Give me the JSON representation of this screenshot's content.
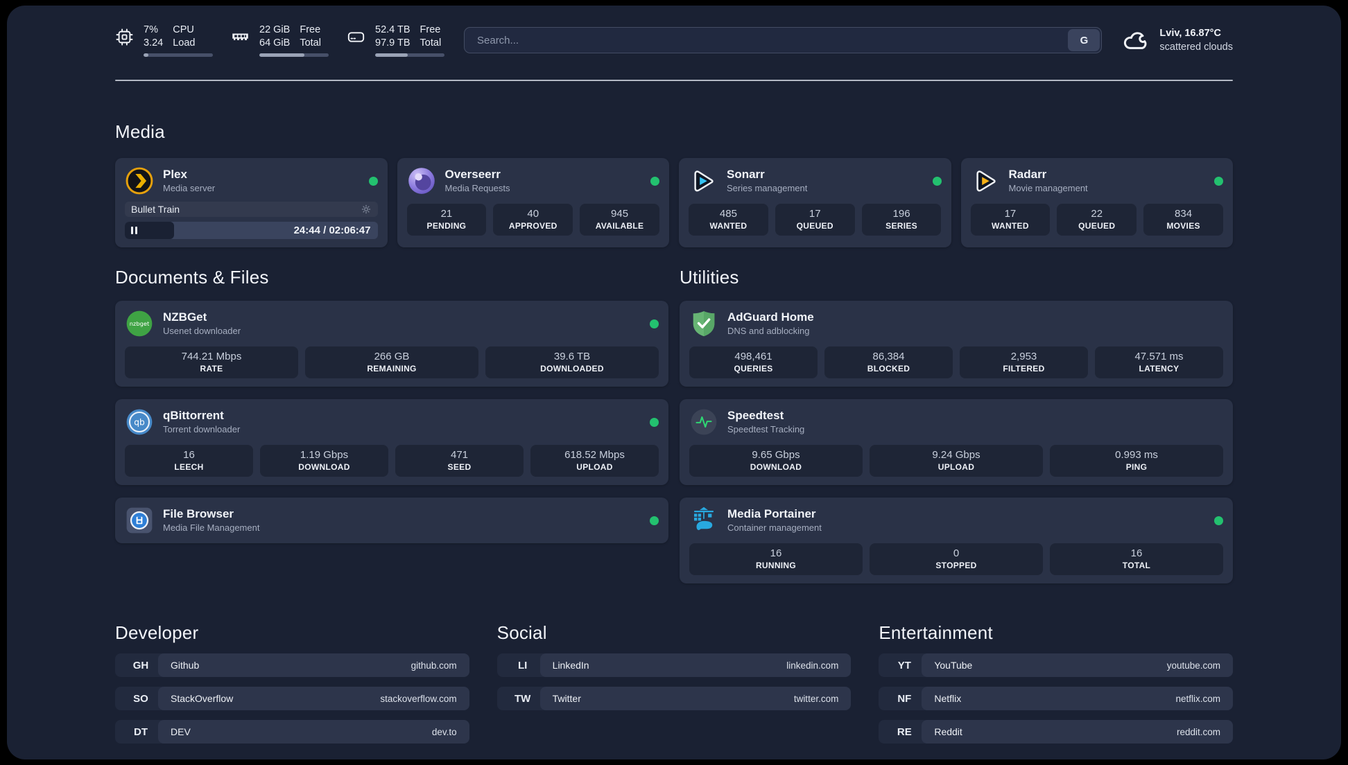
{
  "colors": {
    "status_online": "#23c16f",
    "panel_background": "#1a2133",
    "card_background": "#2a3247"
  },
  "topbar": {
    "stats": [
      {
        "id": "cpu",
        "icon": "cpu-icon",
        "values": [
          "7%",
          "3.24"
        ],
        "labels": [
          "CPU",
          "Load"
        ],
        "progress_percent": 7
      },
      {
        "id": "memory",
        "icon": "ram-icon",
        "values": [
          "22 GiB",
          "64 GiB"
        ],
        "labels": [
          "Free",
          "Total"
        ],
        "progress_percent": 65
      },
      {
        "id": "storage",
        "icon": "disk-icon",
        "values": [
          "52.4 TB",
          "97.9 TB"
        ],
        "labels": [
          "Free",
          "Total"
        ],
        "progress_percent": 46.5
      }
    ],
    "search": {
      "placeholder": "Search...",
      "engine_button": "G"
    },
    "weather": {
      "icon": "cloud-icon",
      "location_temp": "Lviv, 16.87°C",
      "condition": "scattered clouds"
    }
  },
  "sections": {
    "media": "Media",
    "documents": "Documents & Files",
    "utilities": "Utilities",
    "developer": "Developer",
    "social": "Social",
    "entertainment": "Entertainment"
  },
  "apps": {
    "plex": {
      "name": "Plex",
      "subtitle": "Media server",
      "online": true,
      "now_playing": {
        "title": "Bullet Train",
        "time": "24:44 / 02:06:47",
        "progress_percent": 19.5
      }
    },
    "overseerr": {
      "name": "Overseerr",
      "subtitle": "Media Requests",
      "online": true,
      "stats": [
        {
          "value": "21",
          "label": "PENDING"
        },
        {
          "value": "40",
          "label": "APPROVED"
        },
        {
          "value": "945",
          "label": "AVAILABLE"
        }
      ]
    },
    "sonarr": {
      "name": "Sonarr",
      "subtitle": "Series management",
      "online": true,
      "stats": [
        {
          "value": "485",
          "label": "WANTED"
        },
        {
          "value": "17",
          "label": "QUEUED"
        },
        {
          "value": "196",
          "label": "SERIES"
        }
      ]
    },
    "radarr": {
      "name": "Radarr",
      "subtitle": "Movie management",
      "online": true,
      "stats": [
        {
          "value": "17",
          "label": "WANTED"
        },
        {
          "value": "22",
          "label": "QUEUED"
        },
        {
          "value": "834",
          "label": "MOVIES"
        }
      ]
    },
    "nzbget": {
      "name": "NZBGet",
      "subtitle": "Usenet downloader",
      "online": true,
      "stats": [
        {
          "value": "744.21 Mbps",
          "label": "RATE"
        },
        {
          "value": "266 GB",
          "label": "REMAINING"
        },
        {
          "value": "39.6 TB",
          "label": "DOWNLOADED"
        }
      ]
    },
    "qbittorrent": {
      "name": "qBittorrent",
      "subtitle": "Torrent downloader",
      "online": true,
      "stats": [
        {
          "value": "16",
          "label": "LEECH"
        },
        {
          "value": "1.19 Gbps",
          "label": "DOWNLOAD"
        },
        {
          "value": "471",
          "label": "SEED"
        },
        {
          "value": "618.52 Mbps",
          "label": "UPLOAD"
        }
      ]
    },
    "filebrowser": {
      "name": "File Browser",
      "subtitle": "Media File Management",
      "online": true
    },
    "adguard": {
      "name": "AdGuard Home",
      "subtitle": "DNS and adblocking",
      "online": false,
      "stats": [
        {
          "value": "498,461",
          "label": "QUERIES"
        },
        {
          "value": "86,384",
          "label": "BLOCKED"
        },
        {
          "value": "2,953",
          "label": "FILTERED"
        },
        {
          "value": "47.571 ms",
          "label": "LATENCY"
        }
      ]
    },
    "speedtest": {
      "name": "Speedtest",
      "subtitle": "Speedtest Tracking",
      "online": false,
      "stats": [
        {
          "value": "9.65 Gbps",
          "label": "DOWNLOAD"
        },
        {
          "value": "9.24 Gbps",
          "label": "UPLOAD"
        },
        {
          "value": "0.993 ms",
          "label": "PING"
        }
      ]
    },
    "portainer": {
      "name": "Media Portainer",
      "subtitle": "Container management",
      "online": true,
      "stats": [
        {
          "value": "16",
          "label": "RUNNING"
        },
        {
          "value": "0",
          "label": "STOPPED"
        },
        {
          "value": "16",
          "label": "TOTAL"
        }
      ]
    }
  },
  "links": {
    "developer": [
      {
        "abbr": "GH",
        "name": "Github",
        "url": "github.com"
      },
      {
        "abbr": "SO",
        "name": "StackOverflow",
        "url": "stackoverflow.com"
      },
      {
        "abbr": "DT",
        "name": "DEV",
        "url": "dev.to"
      }
    ],
    "social": [
      {
        "abbr": "LI",
        "name": "LinkedIn",
        "url": "linkedin.com"
      },
      {
        "abbr": "TW",
        "name": "Twitter",
        "url": "twitter.com"
      }
    ],
    "entertainment": [
      {
        "abbr": "YT",
        "name": "YouTube",
        "url": "youtube.com"
      },
      {
        "abbr": "NF",
        "name": "Netflix",
        "url": "netflix.com"
      },
      {
        "abbr": "RE",
        "name": "Reddit",
        "url": "reddit.com"
      }
    ]
  }
}
